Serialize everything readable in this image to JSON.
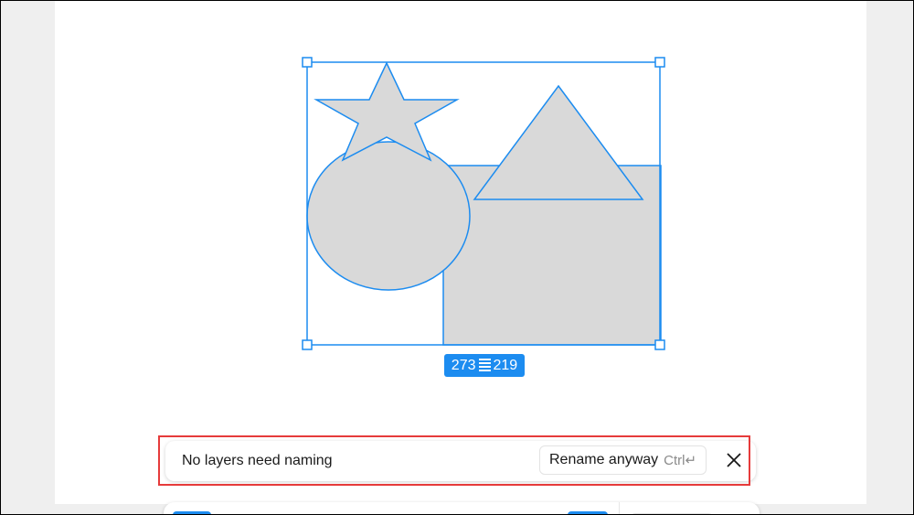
{
  "selection": {
    "width_value": "273",
    "height_value": "219"
  },
  "toast": {
    "message": "No layers need naming",
    "rename_label": "Rename anyway",
    "shortcut": "Ctrl↵",
    "close_icon": "close-icon"
  },
  "colors": {
    "selection": "#1c8cf0",
    "shape_fill": "#d9d9d9",
    "highlight": "#e63b3b"
  }
}
